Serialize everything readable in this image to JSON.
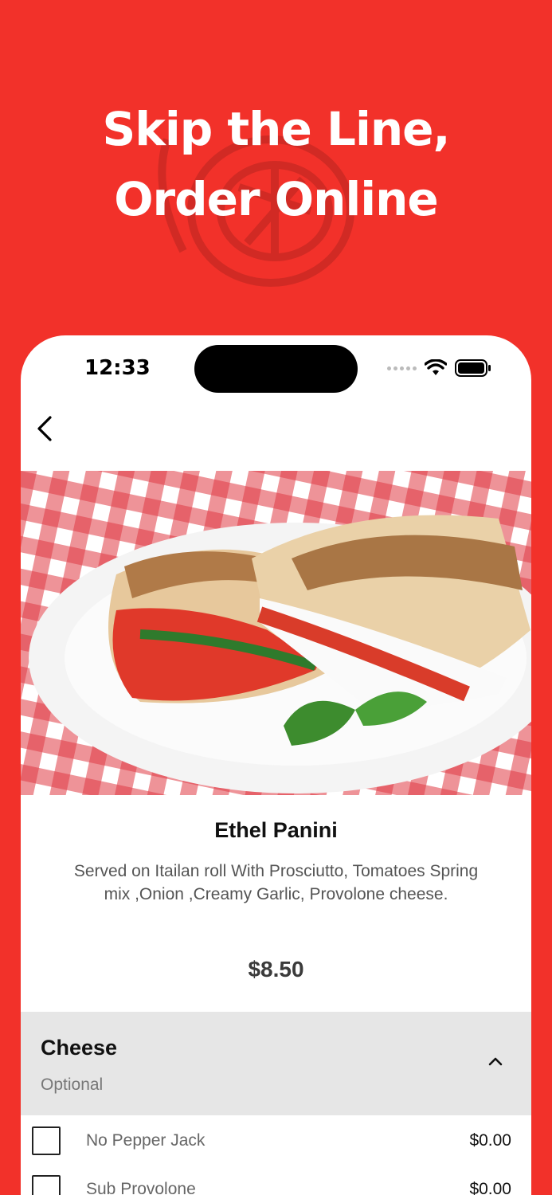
{
  "promo": {
    "headline_line1": "Skip the Line,",
    "headline_line2": "Order Online"
  },
  "status_bar": {
    "time": "12:33"
  },
  "product": {
    "title": "Ethel Panini",
    "description": "Served on Itailan roll With Prosciutto, Tomatoes Spring mix ,Onion ,Creamy Garlic, Provolone cheese.",
    "price": "$8.50"
  },
  "modifier_group": {
    "title": "Cheese",
    "subtitle": "Optional",
    "options": [
      {
        "label": "No Pepper Jack",
        "price": "$0.00"
      },
      {
        "label": "Sub Provolone",
        "price": "$0.00"
      }
    ]
  },
  "colors": {
    "brand_red": "#f2312a",
    "section_gray": "#e6e6e6"
  },
  "icons": {
    "back": "chevron-left-icon",
    "collapse": "chevron-up-icon",
    "wifi": "wifi-icon",
    "battery": "battery-icon"
  }
}
